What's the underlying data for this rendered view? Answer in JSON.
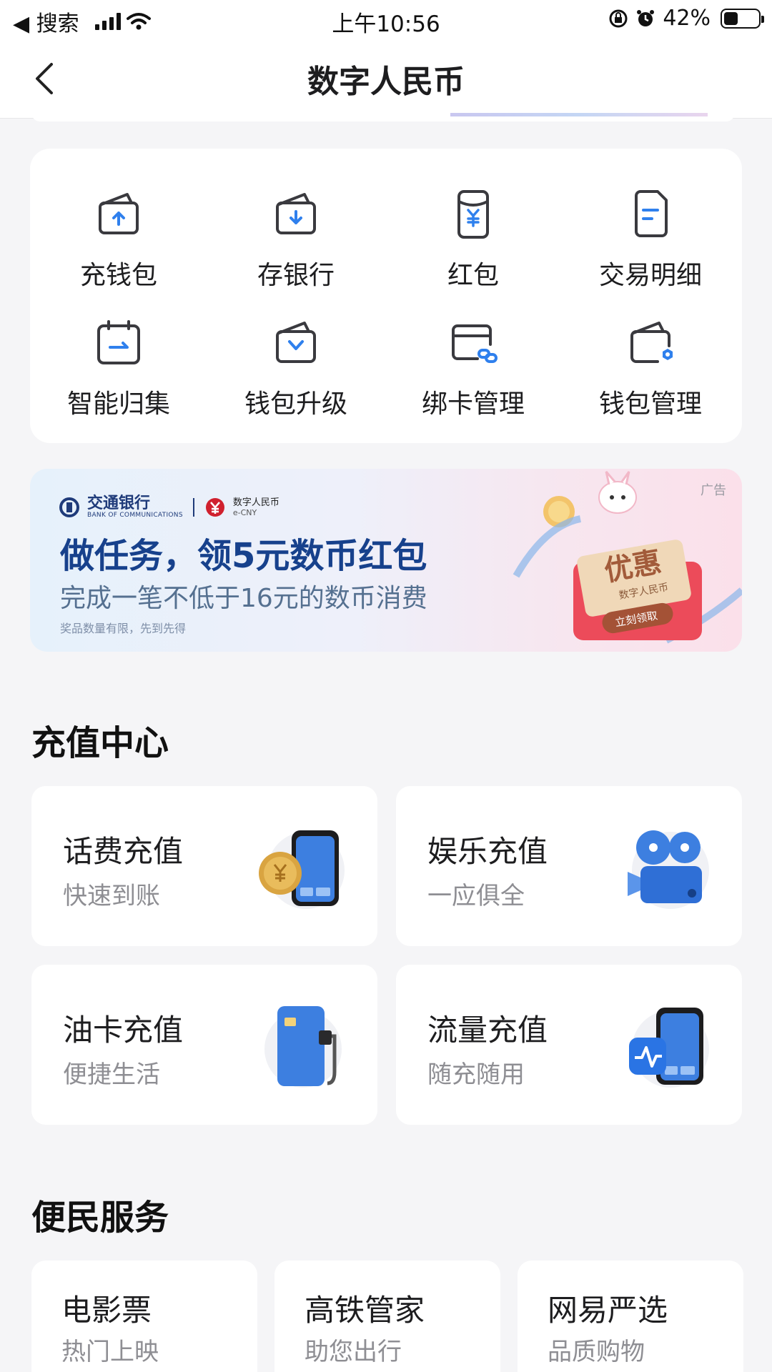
{
  "status_bar": {
    "back_label": "◀ 搜索",
    "time": "上午10:56",
    "battery": "42%",
    "battery_level": 0.42
  },
  "nav": {
    "title": "数字人民币"
  },
  "functions": [
    {
      "label": "充钱包",
      "icon": "wallet-topup-icon"
    },
    {
      "label": "存银行",
      "icon": "deposit-bank-icon"
    },
    {
      "label": "红包",
      "icon": "red-packet-icon"
    },
    {
      "label": "交易明细",
      "icon": "transaction-detail-icon"
    },
    {
      "label": "智能归集",
      "icon": "smart-collect-icon"
    },
    {
      "label": "钱包升级",
      "icon": "wallet-upgrade-icon"
    },
    {
      "label": "绑卡管理",
      "icon": "bind-card-icon"
    },
    {
      "label": "钱包管理",
      "icon": "wallet-settings-icon"
    }
  ],
  "banner": {
    "ad_tag": "广告",
    "bank_name": "交通银行",
    "bank_name_en": "BANK OF COMMUNICATIONS",
    "ecny_name": "数字人民币",
    "ecny_en": "e-CNY",
    "title": "做任务，领5元数币红包",
    "subtitle": "完成一笔不低于16元的数币消费",
    "note": "奖品数量有限，先到先得",
    "coupon_text": "优惠",
    "coupon_sub": "数字人民币",
    "coupon_button": "立刻领取"
  },
  "recharge": {
    "title": "充值中心",
    "items": [
      {
        "title": "话费充值",
        "subtitle": "快速到账",
        "icon": "phone-coin-icon"
      },
      {
        "title": "娱乐充值",
        "subtitle": "一应俱全",
        "icon": "film-projector-icon"
      },
      {
        "title": "油卡充值",
        "subtitle": "便捷生活",
        "icon": "fuel-card-icon"
      },
      {
        "title": "流量充值",
        "subtitle": "随充随用",
        "icon": "data-gb-phone-icon"
      }
    ]
  },
  "services": {
    "title": "便民服务",
    "items": [
      {
        "title": "电影票",
        "subtitle": "热门上映"
      },
      {
        "title": "高铁管家",
        "subtitle": "助您出行"
      },
      {
        "title": "网易严选",
        "subtitle": "品质购物"
      }
    ]
  },
  "colors": {
    "icon_stroke": "#3a3a3f",
    "icon_accent": "#2f80ed",
    "banner_title": "#17418c",
    "page_bg": "#f5f5f7"
  }
}
